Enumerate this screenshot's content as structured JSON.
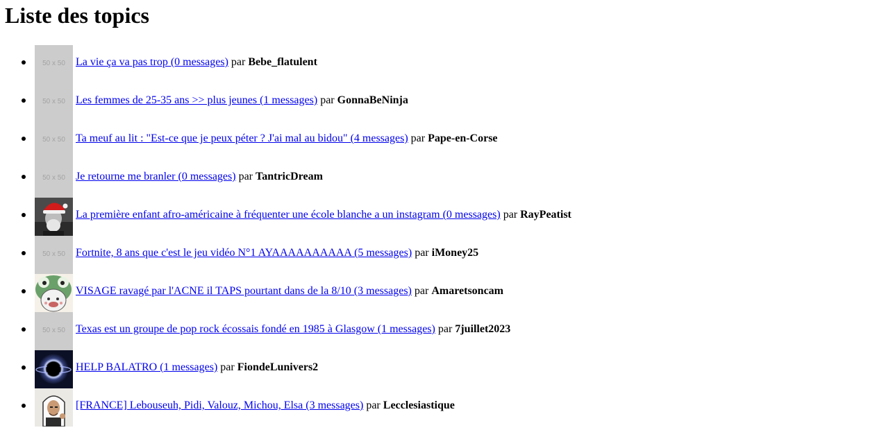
{
  "page": {
    "title": "Liste des topics",
    "by_label": "par",
    "placeholder_text": "50 x 50"
  },
  "topics": [
    {
      "title": "La vie ça va pas trop (0 messages)",
      "author": "Bebe_flatulent",
      "avatar": "placeholder"
    },
    {
      "title": "Les femmes de 25-35 ans >> plus jeunes (1 messages)",
      "author": "GonnaBeNinja",
      "avatar": "placeholder"
    },
    {
      "title": "Ta meuf au lit : \"Est-ce que je peux péter ? J'ai mal au bidou\" (4 messages)",
      "author": "Pape-en-Corse",
      "avatar": "placeholder"
    },
    {
      "title": "Je retourne me branler (0 messages)",
      "author": "TantricDream",
      "avatar": "placeholder"
    },
    {
      "title": "La première enfant afro-américaine à fréquenter une école blanche a un instagram (0 messages)",
      "author": "RayPeatist",
      "avatar": "santa-hat-portrait"
    },
    {
      "title": "Fortnite, 8 ans que c'est le jeu vidéo N°1 AYAAAAAAAAAA (5 messages)",
      "author": "iMoney25",
      "avatar": "placeholder"
    },
    {
      "title": "VISAGE ravagé par l'ACNE il TAPS pourtant dans de la 8/10 (3 messages)",
      "author": "Amaretsoncam",
      "avatar": "frog-cartoon"
    },
    {
      "title": "Texas est un groupe de pop rock écossais fondé en 1985 à Glasgow (1 messages)",
      "author": "7juillet2023",
      "avatar": "placeholder"
    },
    {
      "title": "HELP BALATRO (1 messages)",
      "author": "FiondeLunivers2",
      "avatar": "black-hole"
    },
    {
      "title": "[FRANCE] Lebouseuh, Pidi, Valouz, Michou, Elsa (3 messages)",
      "author": "Lecclesiastique",
      "avatar": "pope-portrait"
    }
  ]
}
